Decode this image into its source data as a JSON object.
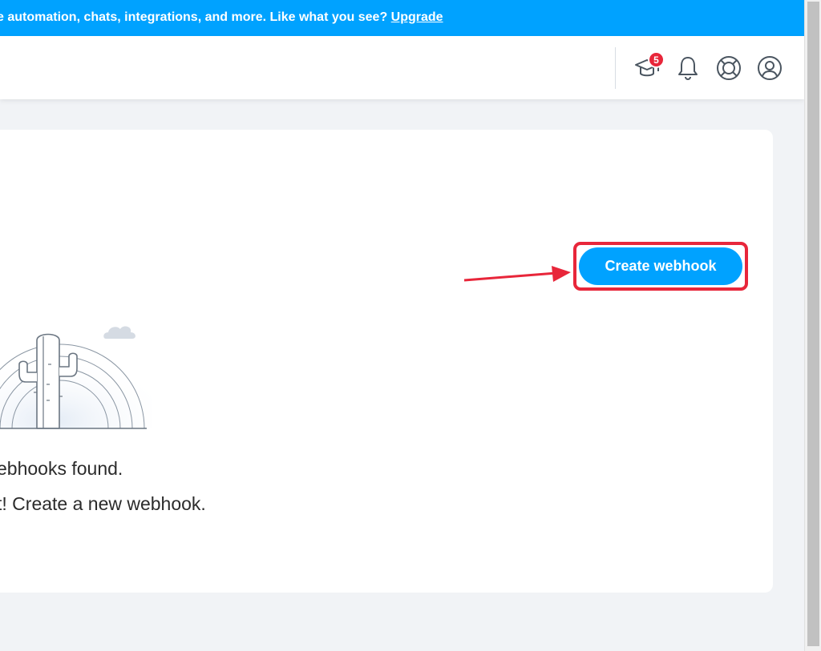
{
  "promo": {
    "text": "e automation, chats, integrations, and more. Like what you see?",
    "link": "Upgrade"
  },
  "header": {
    "academy_badge": "5",
    "icons": [
      "graduation-cap-icon",
      "bell-icon",
      "lifebuoy-icon",
      "user-avatar-icon"
    ]
  },
  "main": {
    "create_button": "Create webhook",
    "empty_title": "ebhooks found.",
    "empty_subtitle": "t! Create a new webhook."
  },
  "colors": {
    "accent": "#00a2ff",
    "highlight": "#e8263a",
    "badge": "#e8263a"
  }
}
